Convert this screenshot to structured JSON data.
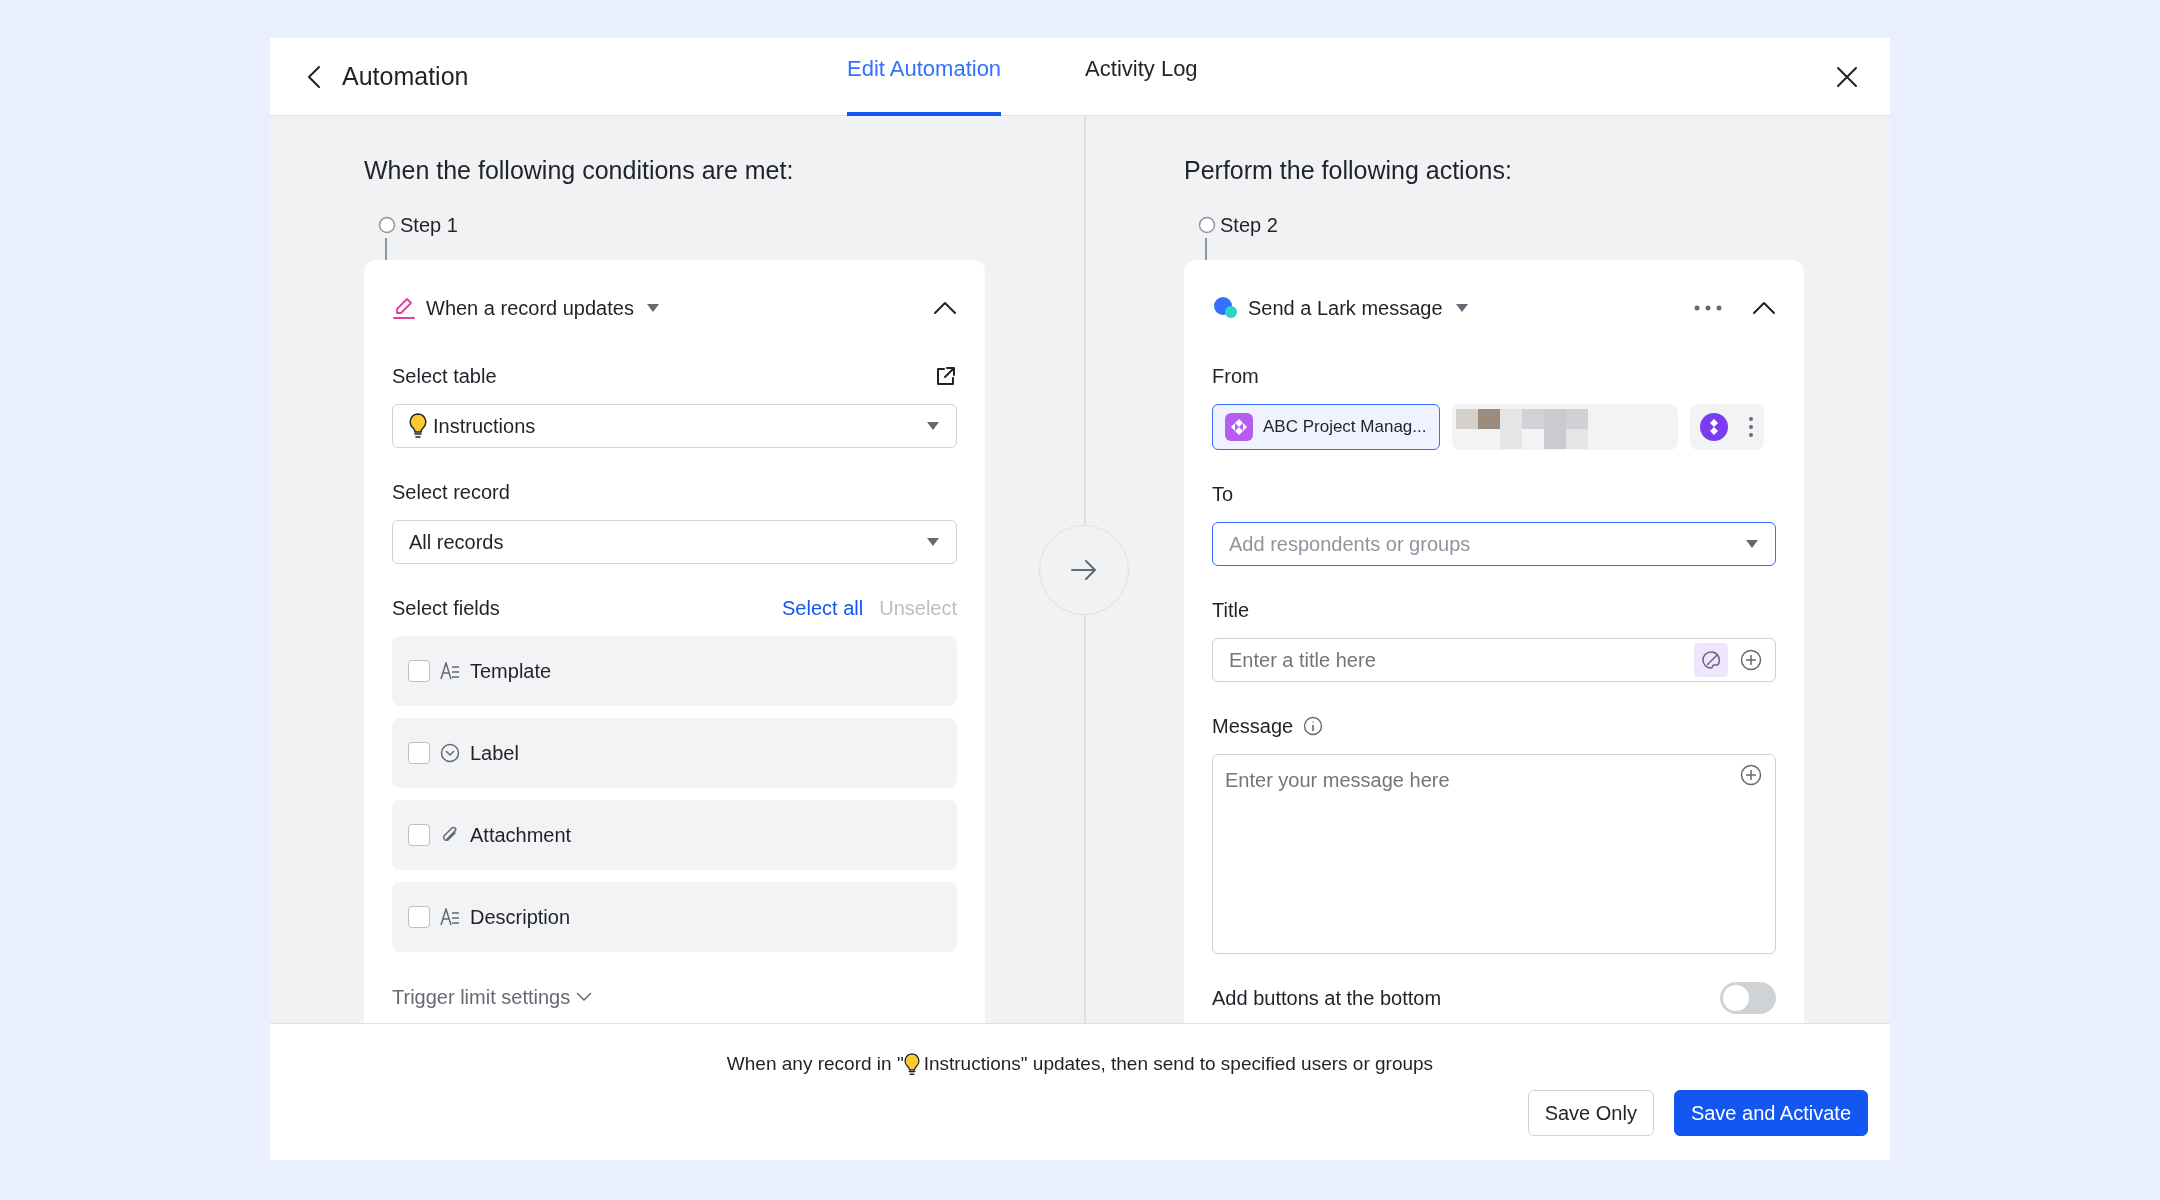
{
  "header": {
    "title": "Automation"
  },
  "tabs": [
    {
      "label": "Edit Automation",
      "selected": true
    },
    {
      "label": "Activity Log",
      "selected": false
    }
  ],
  "conditions": {
    "heading": "When the following conditions are met:",
    "step": "Step 1",
    "card": {
      "title": "When a record updates",
      "expanded": true,
      "table_label": "Select table",
      "table_value": "Instructions",
      "record_label": "Select record",
      "record_value": "All records",
      "fields_label": "Select fields",
      "select_all": "Select all",
      "unselect": "Unselect",
      "unselect_disabled": true,
      "fields": [
        {
          "name": "Template",
          "kind": "text",
          "checked": false
        },
        {
          "name": "Label",
          "kind": "select",
          "checked": false
        },
        {
          "name": "Attachment",
          "kind": "attachment",
          "checked": false
        },
        {
          "name": "Description",
          "kind": "text",
          "checked": false
        }
      ],
      "trigger_limit": "Trigger limit settings"
    }
  },
  "actions": {
    "heading": "Perform the following actions:",
    "step": "Step 2",
    "card": {
      "title": "Send a Lark message",
      "expanded": true,
      "from_label": "From",
      "sender": "ABC Project Manag...",
      "to_label": "To",
      "to_placeholder": "Add respondents or groups",
      "title_label": "Title",
      "title_placeholder": "Enter a title here",
      "message_label": "Message",
      "message_placeholder": "Enter your message here",
      "bottom_buttons_label": "Add buttons at the bottom",
      "bottom_buttons_on": false
    }
  },
  "footer": {
    "summary_before": "When any record in \"",
    "summary_table": "Instructions",
    "summary_after": "\" updates, then send to specified users or groups",
    "buttons": [
      {
        "label": "Save Only",
        "kind": "secondary"
      },
      {
        "label": "Save and Activate",
        "kind": "primary"
      }
    ]
  }
}
